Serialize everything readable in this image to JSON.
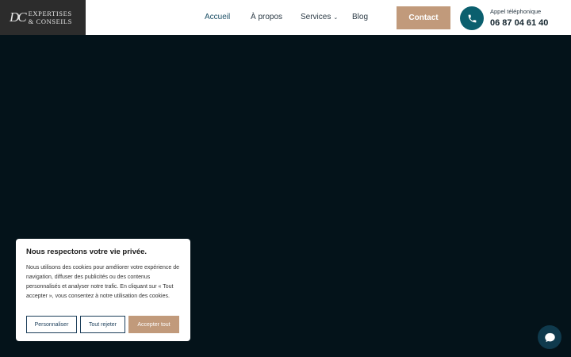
{
  "logo": {
    "mark": "DC",
    "line1": "EXPERTISES",
    "line2": "& CONSEILS"
  },
  "nav": {
    "home": "Accueil",
    "about": "À propos",
    "services": "Services",
    "blog": "Blog"
  },
  "contact_button": "Contact",
  "phone": {
    "label": "Appel téléphonique",
    "number": "06 87 04 61 40"
  },
  "cookie_banner": {
    "title": "Nous respectons votre vie privée.",
    "text": "Nous utilisons des cookies pour améliorer votre expérience de navigation, diffuser des publicités ou des contenus personnalisés et analyser notre trafic. En cliquant sur « Tout accepter », vous consentez à notre utilisation des cookies.",
    "customize": "Personnaliser",
    "reject": "Tout rejeter",
    "accept": "Accepter tout"
  },
  "icons": {
    "phone": "phone-icon",
    "chat": "chat-icon",
    "chevron": "chevron-down-icon"
  },
  "colors": {
    "accent": "#c19a7b",
    "teal": "#0b5f6e",
    "background": "#04131a"
  }
}
